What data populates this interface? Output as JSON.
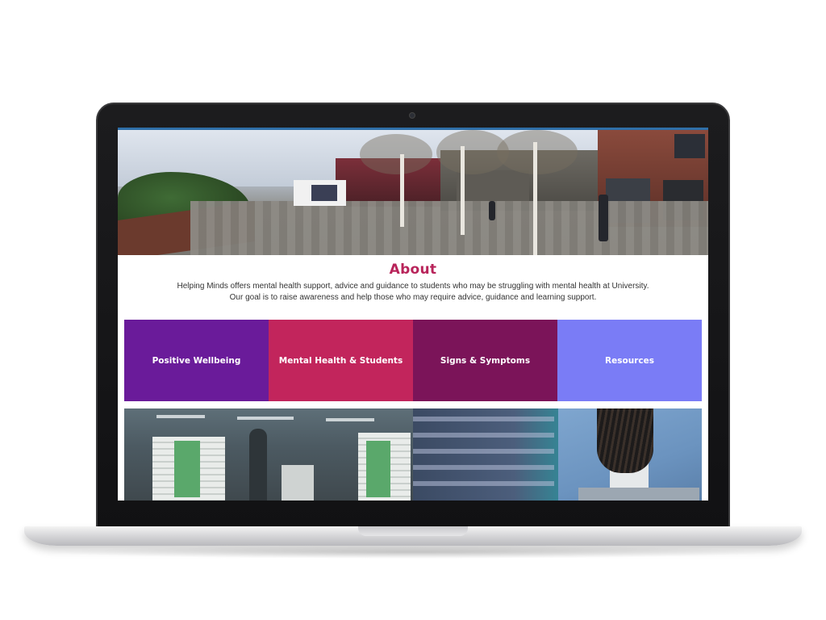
{
  "about": {
    "title": "About",
    "line1": "Helping Minds offers mental health support, advice and guidance to students who may be struggling with mental health at University.",
    "line2": "Our goal is to raise awareness and help those who may require advice, guidance and learning support."
  },
  "tiles": [
    {
      "label": "Positive Wellbeing",
      "color": "#6a1b9a"
    },
    {
      "label": "Mental Health & Students",
      "color": "#c2255c"
    },
    {
      "label": "Signs & Symptoms",
      "color": "#7b1459"
    },
    {
      "label": "Resources",
      "color": "#7a7cf6"
    }
  ],
  "colors": {
    "accent": "#b8245a",
    "laptop_bezel": "#111113",
    "screen_top_bar": "#2f6fa8"
  },
  "images": {
    "hero": "campus-photo",
    "left": "library-photo",
    "right": "students-photo"
  }
}
